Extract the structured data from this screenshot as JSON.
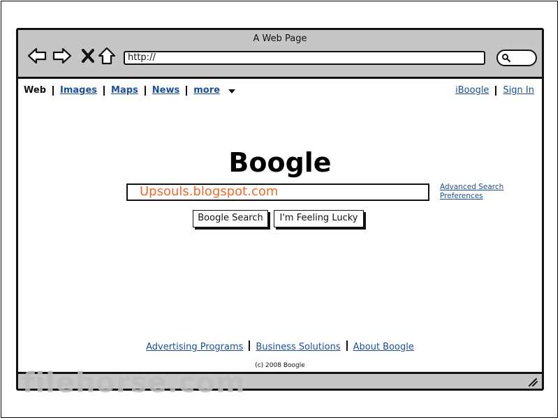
{
  "window": {
    "title": "A Web Page"
  },
  "browser": {
    "url": "http://"
  },
  "nav": {
    "current": "Web",
    "links": [
      "Images",
      "Maps",
      "News",
      "more"
    ],
    "right": [
      "iBoogle",
      "Sign In"
    ]
  },
  "main": {
    "logo": "Boogle",
    "query": "Upsouls.blogspot.com",
    "advanced_search": "Advanced Search",
    "preferences": "Preferences",
    "search_button": "Boogle Search",
    "lucky_button": "I'm Feeling Lucky"
  },
  "footer": {
    "links": [
      "Advertising Programs",
      "Business Solutions",
      "About Boogle"
    ],
    "copyright": "(c) 2008 Boogle"
  },
  "watermark": "filehorse.com",
  "colors": {
    "link": "#1a4f96",
    "query_text": "#f0682a",
    "chrome": "#c6c6c6"
  }
}
